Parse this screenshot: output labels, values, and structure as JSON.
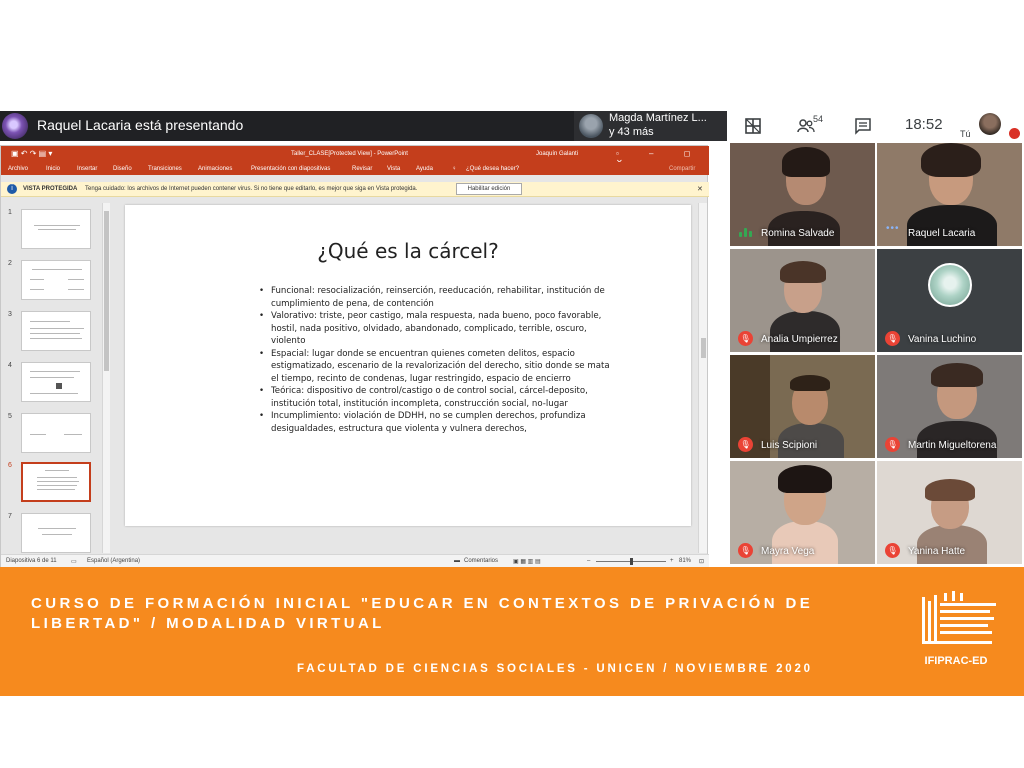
{
  "meet": {
    "presenting": "Raquel Lacaria está presentando",
    "viewer_name": "Magda Martínez L...",
    "viewer_more": "y 43 más",
    "people_count": "54",
    "clock": "18:52",
    "self_label": "Tú"
  },
  "powerpoint": {
    "window_title": "Taller_CLASE[Protected View] - PowerPoint",
    "user_name": "Joaquín Galanti",
    "menu": [
      "Archivo",
      "Inicio",
      "Insertar",
      "Diseño",
      "Transiciones",
      "Animaciones",
      "Presentación con diapositivas",
      "Revisar",
      "Vista",
      "Ayuda"
    ],
    "tell_me": "¿Qué desea hacer?",
    "share": "Compartir",
    "protected_label": "VISTA PROTEGIDA",
    "protected_message": "Tenga cuidado: los archivos de Internet pueden contener virus. Si no tiene que editarlo, es mejor que siga en Vista protegida.",
    "enable_editing": "Habilitar edición",
    "thumb_numbers": [
      "1",
      "2",
      "3",
      "4",
      "5",
      "6",
      "7"
    ],
    "slide_title": "¿Qué es la cárcel?",
    "bullets": [
      "Funcional: resocialización, reinserción, reeducación, rehabilitar, institución de cumplimiento de pena, de contención",
      "Valorativo: triste, peor castigo, mala respuesta, nada bueno, poco favorable, hostil, nada positivo, olvidado, abandonado, complicado, terrible, oscuro, violento",
      "Espacial: lugar donde se encuentran quienes cometen delitos, espacio estigmatizado, escenario de la revalorización del derecho, sitio donde se mata el tiempo, recinto de condenas, lugar restringido, espacio de encierro",
      "Teórica: dispositivo de control/castigo o de control social, cárcel-deposito, institución total, institución incompleta, construcción social, no-lugar",
      "Incumplimiento: violación de DDHH, no se cumplen derechos, profundiza desigualdades, estructura que violenta y vulnera derechos,"
    ],
    "status_slide": "Diapositiva 6 de 11",
    "status_language": "Español (Argentina)",
    "status_comments": "Comentarios",
    "zoom": "81%"
  },
  "participants": [
    {
      "name": "Romina Salvade",
      "status": "speaking"
    },
    {
      "name": "Raquel Lacaria",
      "status": "presenting"
    },
    {
      "name": "Analia Umpierrez",
      "status": "muted"
    },
    {
      "name": "Vanina Luchino",
      "status": "muted"
    },
    {
      "name": "Luis Scipioni",
      "status": "muted"
    },
    {
      "name": "Martin Migueltorena",
      "status": "muted"
    },
    {
      "name": "Mayra Vega",
      "status": "muted"
    },
    {
      "name": "Yanina Hatte",
      "status": "muted"
    }
  ],
  "banner": {
    "course_line1": "CURSO DE FORMACIÓN INICIAL \"EDUCAR EN CONTEXTOS DE PRIVACIÓN DE",
    "course_line2": "LIBERTAD\" / MODALIDAD VIRTUAL",
    "faculty": "FACULTAD DE CIENCIAS SOCIALES - UNICEN / NOVIEMBRE 2020",
    "logo_text": "IFIPRAC-ED"
  },
  "colors": {
    "banner": "#f68a1e",
    "ppt_accent": "#c43e1c",
    "meet_dark": "#202124",
    "muted_red": "#ea4335"
  }
}
